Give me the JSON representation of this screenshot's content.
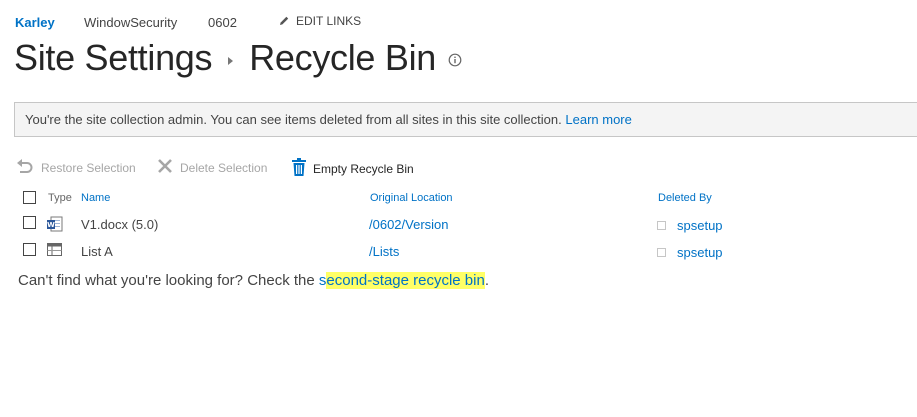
{
  "topnav": {
    "items": [
      "Karley",
      "WindowSecurity",
      "0602"
    ],
    "edit_links": "EDIT LINKS"
  },
  "title": {
    "parent": "Site Settings",
    "current": "Recycle Bin"
  },
  "banner": {
    "text": "You're the site collection admin. You can see items deleted from all sites in this site collection.",
    "link": "Learn more"
  },
  "toolbar": {
    "restore": "Restore Selection",
    "delete": "Delete Selection",
    "empty": "Empty Recycle Bin"
  },
  "table": {
    "headers": {
      "type": "Type",
      "name": "Name",
      "original_location": "Original Location",
      "deleted_by": "Deleted By"
    },
    "rows": [
      {
        "type_icon": "word-document-icon",
        "name": "V1.docx (5.0)",
        "original_location": "/0602/Version",
        "deleted_by": "spsetup"
      },
      {
        "type_icon": "list-icon",
        "name": "List A",
        "original_location": "/Lists",
        "deleted_by": "spsetup"
      }
    ]
  },
  "footer": {
    "prefix": "Can't find what you're looking for? Check the ",
    "link_unhighlighted": "s",
    "link_highlighted": "econd-stage recycle bin",
    "suffix": "."
  },
  "colors": {
    "accent": "#0072c6",
    "highlight": "#ffff66",
    "recycle_icon": "#0072c6"
  }
}
